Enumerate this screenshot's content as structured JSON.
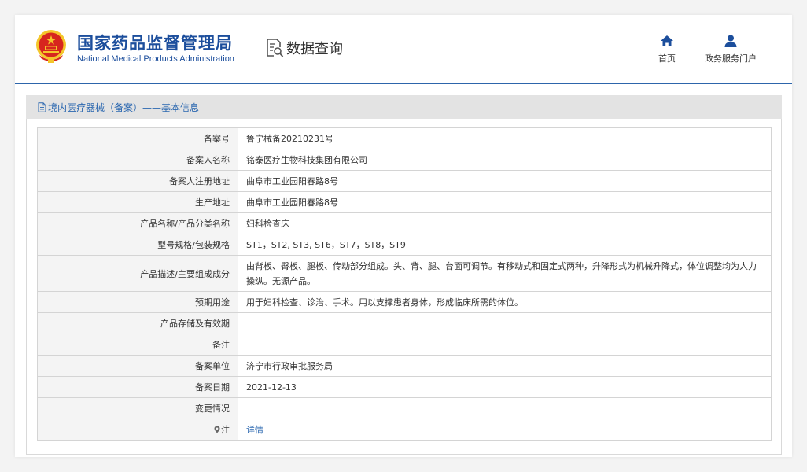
{
  "header": {
    "brand_cn": "国家药品监督管理局",
    "brand_en": "National Medical Products Administration",
    "query_label": "数据查询",
    "nav": [
      {
        "label": "首页",
        "icon": "home-icon"
      },
      {
        "label": "政务服务门户",
        "icon": "user-icon"
      }
    ]
  },
  "panel": {
    "title": "境内医疗器械（备案）——基本信息"
  },
  "rows": [
    {
      "label": "备案号",
      "value": "鲁宁械备20210231号"
    },
    {
      "label": "备案人名称",
      "value": "铭泰医疗生物科技集团有限公司"
    },
    {
      "label": "备案人注册地址",
      "value": "曲阜市工业园阳春路8号"
    },
    {
      "label": "生产地址",
      "value": "曲阜市工业园阳春路8号"
    },
    {
      "label": "产品名称/产品分类名称",
      "value": "妇科检查床"
    },
    {
      "label": "型号规格/包装规格",
      "value": "ST1，ST2, ST3, ST6，ST7，ST8，ST9"
    },
    {
      "label": "产品描述/主要组成成分",
      "value": "由背板、臀板、腿板、传动部分组成。头、背、腿、台面可调节。有移动式和固定式两种，升降形式为机械升降式，体位调整均为人力操纵。无源产品。"
    },
    {
      "label": "预期用途",
      "value": "用于妇科检查、诊治、手术。用以支撑患者身体，形成临床所需的体位。"
    },
    {
      "label": "产品存储及有效期",
      "value": ""
    },
    {
      "label": "备注",
      "value": ""
    },
    {
      "label": "备案单位",
      "value": "济宁市行政审批服务局"
    },
    {
      "label": "备案日期",
      "value": "2021-12-13"
    },
    {
      "label": "变更情况",
      "value": ""
    }
  ],
  "note_row": {
    "label": "注",
    "value": "详情",
    "icon": "map-pin-icon"
  },
  "colors": {
    "brand_blue": "#1c4e9c",
    "accent_blue": "#2c68b0",
    "header_rule": "#2d65ab",
    "emblem_red": "#d7261e",
    "emblem_gold": "#f4c62b"
  }
}
